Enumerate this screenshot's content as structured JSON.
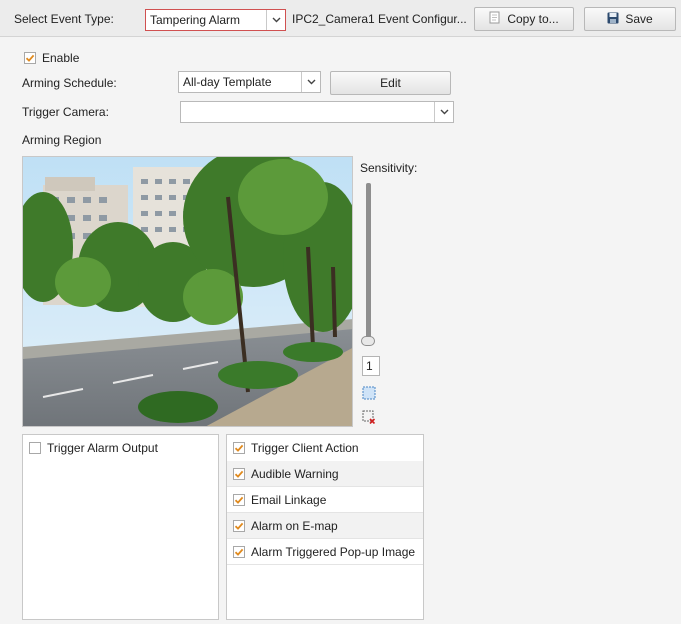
{
  "toolbar": {
    "event_type_label": "Select Event Type:",
    "event_type_value": "Tampering Alarm",
    "config_title": "IPC2_Camera1 Event Configur...",
    "copy_label": "Copy to...",
    "save_label": "Save"
  },
  "form": {
    "enable_label": "Enable",
    "enable_checked": true,
    "arming_schedule_label": "Arming Schedule:",
    "arming_schedule_value": "All-day Template",
    "edit_label": "Edit",
    "trigger_camera_label": "Trigger Camera:",
    "trigger_camera_value": "",
    "arming_region_label": "Arming Region"
  },
  "sensitivity": {
    "label": "Sensitivity:",
    "value": "1",
    "min": 0,
    "max": 100,
    "level": 1
  },
  "alarm_output": {
    "label": "Trigger Alarm Output",
    "checked": false
  },
  "client_action": {
    "label": "Trigger Client Action",
    "items": [
      {
        "label": "Audible Warning",
        "checked": true
      },
      {
        "label": "Email Linkage",
        "checked": true
      },
      {
        "label": "Alarm on E-map",
        "checked": true
      },
      {
        "label": "Alarm Triggered Pop-up Image",
        "checked": true
      }
    ]
  },
  "colors": {
    "accent_border": "#d05050",
    "check_orange": "#e08a1e"
  }
}
